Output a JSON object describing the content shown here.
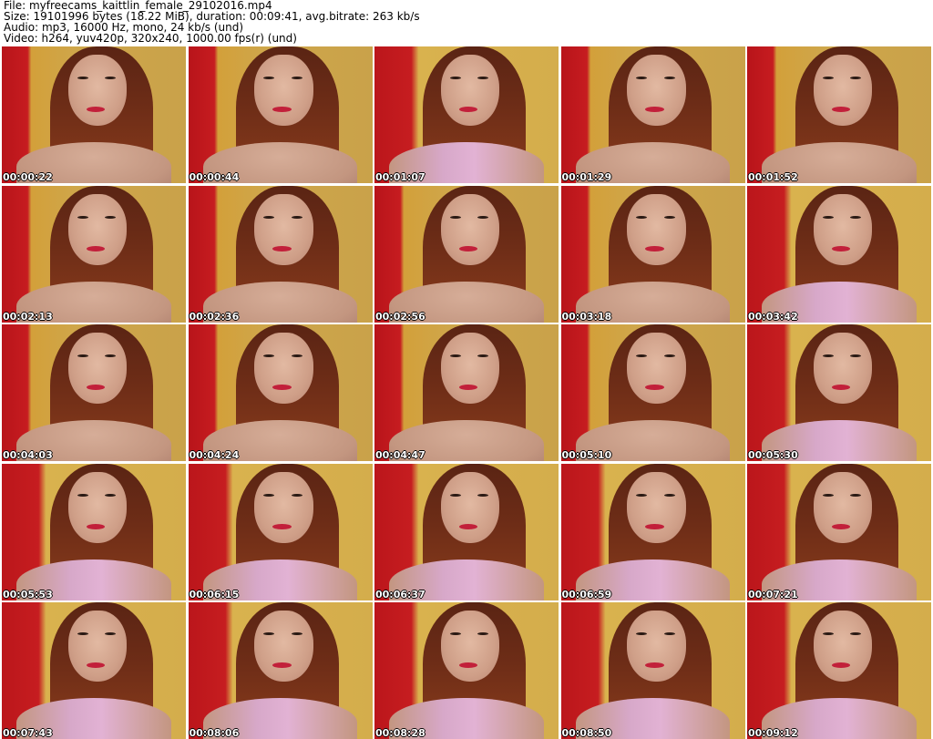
{
  "header": {
    "file": "File: myfreecams_kaittlin_female_29102016.mp4",
    "size": "Size: 19101996 bytes (18.22 MiB), duration: 00:09:41, avg.bitrate: 263 kb/s",
    "audio": "Audio: mp3, 16000 Hz, mono, 24 kb/s (und)",
    "video": "Video: h264, yuv420p, 320x240, 1000.00 fps(r) (und)"
  },
  "thumbnails": [
    "00:00:22",
    "00:00:44",
    "00:01:07",
    "00:01:29",
    "00:01:52",
    "00:02:13",
    "00:02:36",
    "00:02:56",
    "00:03:18",
    "00:03:42",
    "00:04:03",
    "00:04:24",
    "00:04:47",
    "00:05:10",
    "00:05:30",
    "00:05:53",
    "00:06:15",
    "00:06:37",
    "00:06:59",
    "00:07:21",
    "00:07:43",
    "00:08:06",
    "00:08:28",
    "00:08:50",
    "00:09:12"
  ]
}
